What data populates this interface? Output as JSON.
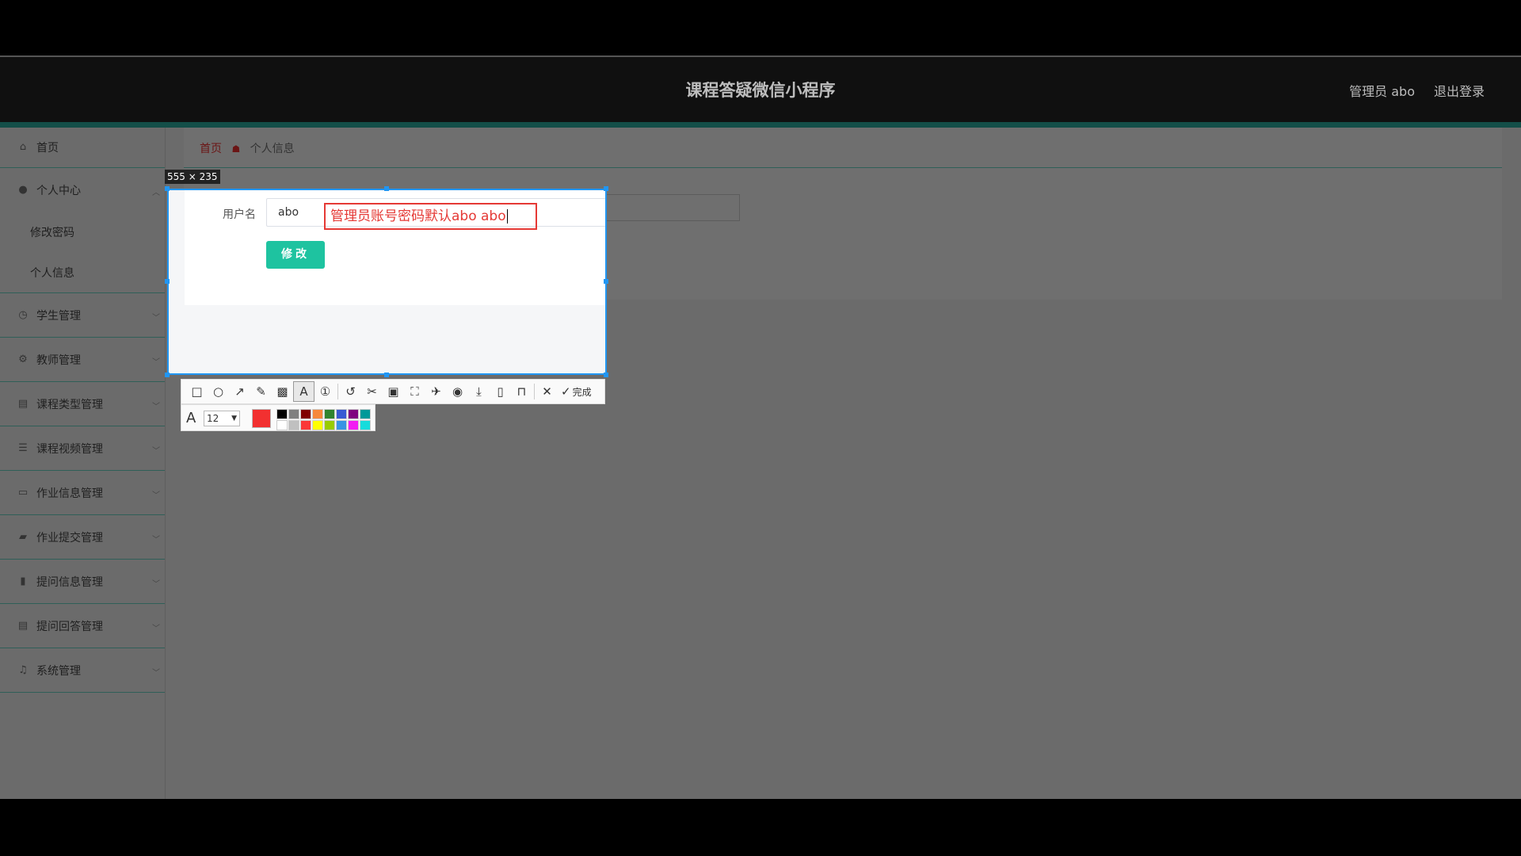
{
  "header": {
    "title": "课程答疑微信小程序",
    "user": "管理员 abo",
    "logout": "退出登录"
  },
  "sidebar": {
    "items": [
      {
        "label": "首页",
        "icon": "home-icon"
      },
      {
        "label": "个人中心",
        "icon": "user-icon"
      },
      {
        "label": "学生管理",
        "icon": "clock-icon"
      },
      {
        "label": "教师管理",
        "icon": "settings-icon"
      },
      {
        "label": "课程类型管理",
        "icon": "clipboard-icon"
      },
      {
        "label": "课程视频管理",
        "icon": "list-icon"
      },
      {
        "label": "作业信息管理",
        "icon": "monitor-icon"
      },
      {
        "label": "作业提交管理",
        "icon": "briefcase-icon"
      },
      {
        "label": "提问信息管理",
        "icon": "bar-chart-icon"
      },
      {
        "label": "提问回答管理",
        "icon": "clipboard-icon"
      },
      {
        "label": "系统管理",
        "icon": "bell-icon"
      }
    ],
    "subitems": [
      {
        "label": "修改密码"
      },
      {
        "label": "个人信息"
      }
    ]
  },
  "breadcrumb": {
    "home": "首页",
    "current": "个人信息"
  },
  "form": {
    "username_label": "用户名",
    "username_value": "abo",
    "submit_label": "修改"
  },
  "capture": {
    "size_label": "555 × 235",
    "annotation_text": "管理员账号密码默认abo abo",
    "font_size": "12",
    "done_label": "完成",
    "current_color": "#f23030",
    "palette": [
      "#000000",
      "#808080",
      "#800000",
      "#f7883a",
      "#308430",
      "#385ad3",
      "#800080",
      "#009999",
      "#ffffff",
      "#c0c0c0",
      "#fb3838",
      "#ffff00",
      "#99cc00",
      "#3894e4",
      "#f31bf3",
      "#16dcdc"
    ]
  },
  "colors": {
    "accent": "#1ec3a0",
    "selection": "#2196f3",
    "annotation": "#e53935"
  }
}
